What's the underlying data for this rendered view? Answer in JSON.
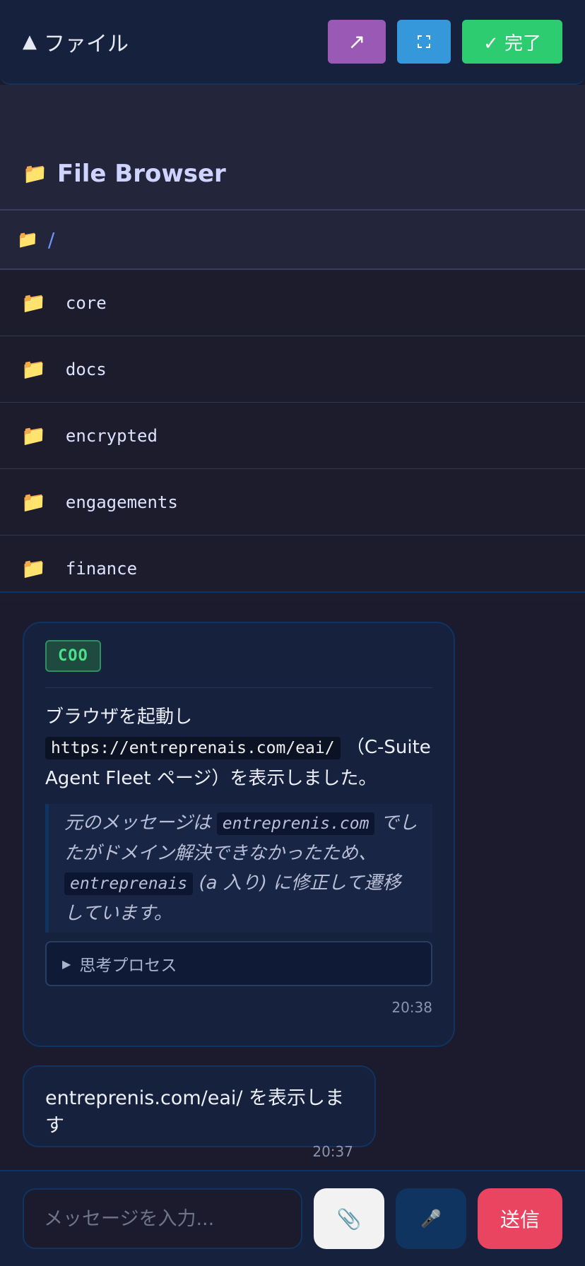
{
  "header": {
    "title_icon": "▲",
    "title": "ファイル",
    "share_icon": "↗",
    "done_label": "✓ 完了"
  },
  "file_browser": {
    "title_icon": "📁",
    "title": "File Browser",
    "path_icon": "📁",
    "path": "/",
    "items": [
      {
        "icon": "📁",
        "name": "core"
      },
      {
        "icon": "📁",
        "name": "docs"
      },
      {
        "icon": "📁",
        "name": "encrypted"
      },
      {
        "icon": "📁",
        "name": "engagements"
      },
      {
        "icon": "📁",
        "name": "finance"
      }
    ]
  },
  "messages": {
    "assistant": {
      "badge": "COO",
      "text_before": "ブラウザを起動し",
      "url_code": "https://entreprenais.com/eai/",
      "text_after": "（C-Suite Agent Fleet ページ）を表示しました。",
      "quote_part1": "元のメッセージは",
      "quote_code1": "entreprenis.com",
      "quote_part2": "でしたがドメイン解決できなかったため、",
      "quote_code2": "entreprenais",
      "quote_part3": "(a 入り) に修正して遷移しています。",
      "thought_label": "思考プロセス",
      "time": "20:38"
    },
    "user": {
      "text": "entreprenis.com/eai/ を表示します",
      "time": "20:37"
    }
  },
  "input": {
    "placeholder": "メッセージを入力...",
    "attach_icon": "📎",
    "mic_icon": "🎤",
    "send_label": "送信"
  },
  "colors": {
    "background": "#1b1b2d",
    "panel": "#16213e",
    "accent_border": "#0f3460",
    "send": "#e94560",
    "share": "#9b59b6",
    "expand": "#3498db",
    "done": "#2ecc71",
    "badge_text": "#4ee08a"
  }
}
